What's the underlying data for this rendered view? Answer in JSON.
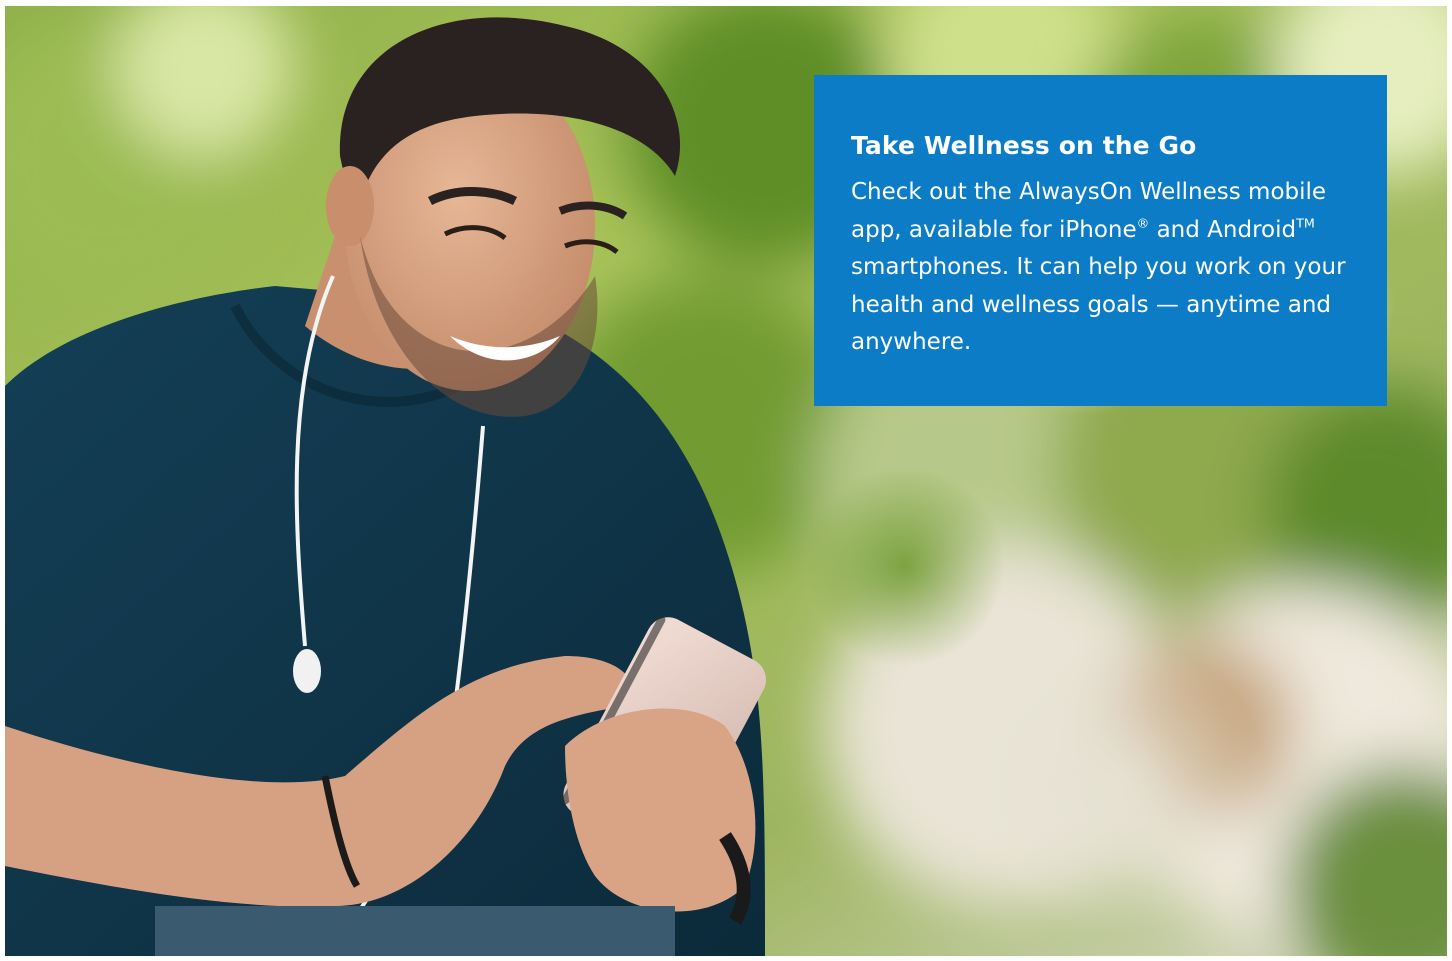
{
  "colors": {
    "callout_background": "#0d7cc7",
    "callout_text": "#ffffff",
    "page_border": "#ffffff"
  },
  "photo": {
    "subject": "smiling man in dark teal t-shirt with white earphones using a smartphone outdoors, blurred green park background"
  },
  "callout": {
    "title": "Take Wellness on the Go",
    "body_part1": "Check out the AlwaysOn Wellness mobile app, available for iPhone",
    "registered_mark": "®",
    "body_part2": " and Android",
    "trademark": "TM",
    "body_part3": " smartphones. It can help you work on your health and wellness goals — anytime and anywhere."
  }
}
